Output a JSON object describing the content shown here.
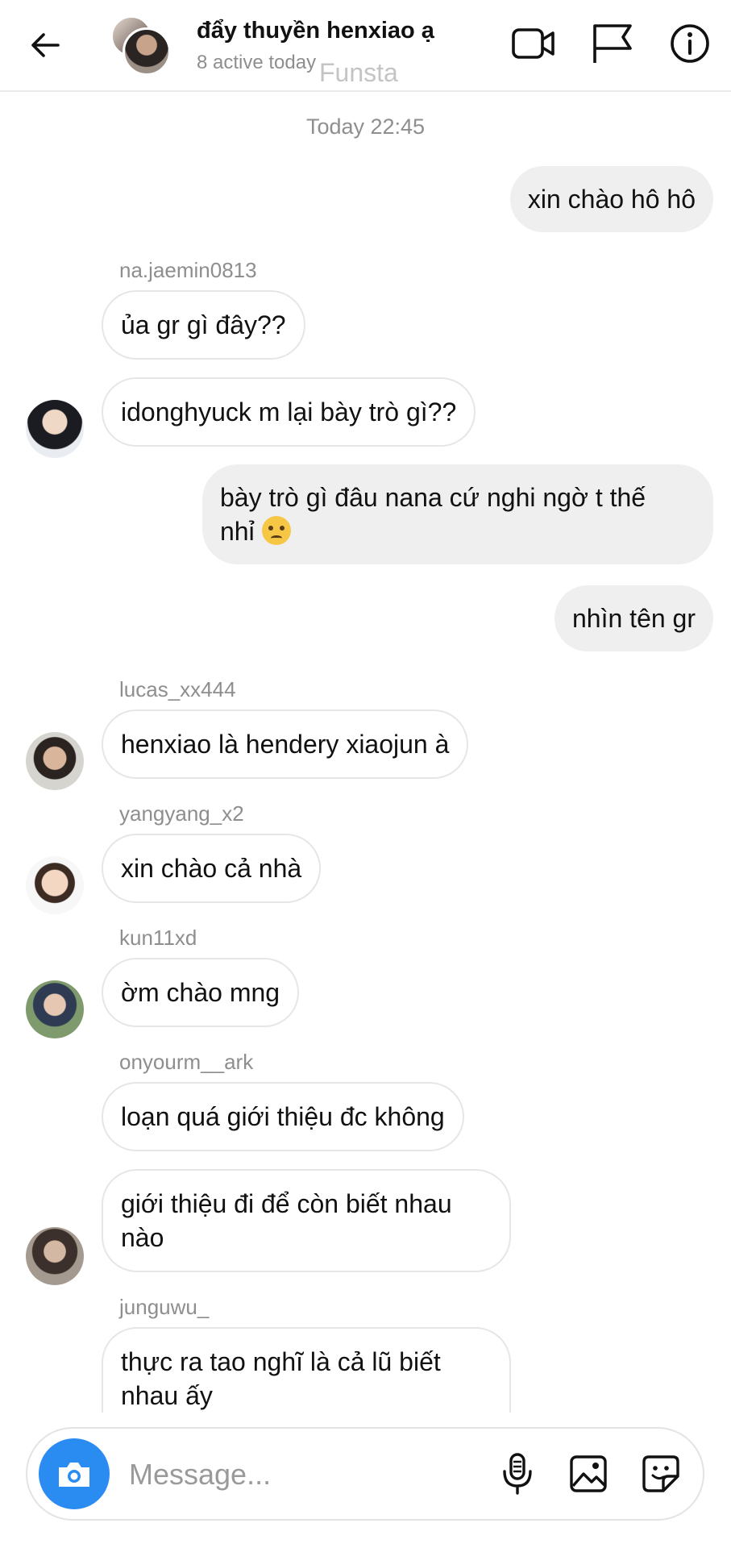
{
  "header": {
    "title": "đẩy thuyền henxiao ạ",
    "subtitle": "8 active today",
    "watermark": "Funsta",
    "icons": [
      "back-arrow-icon",
      "video-camera-icon",
      "flag-icon",
      "info-icon"
    ]
  },
  "timestamp": "Today 22:45",
  "messages": [
    {
      "direction": "out",
      "text": "xin chào hô hô"
    },
    {
      "direction": "in",
      "sender": "na.jaemin0813",
      "text": "ủa gr gì đây??"
    },
    {
      "direction": "in",
      "text": "idonghyuck m lại bày trò gì??"
    },
    {
      "direction": "out",
      "text_line1": "bày trò gì đâu nana cứ nghi ngờ t thế",
      "text_line2": "nhỉ",
      "emoji": "angry-face-emoji"
    },
    {
      "direction": "out",
      "text": "nhìn tên gr"
    },
    {
      "direction": "in",
      "sender": "lucas_xx444",
      "text": "henxiao là hendery xiaojun à"
    },
    {
      "direction": "in",
      "sender": "yangyang_x2",
      "text": "xin chào cả nhà"
    },
    {
      "direction": "in",
      "sender": "kun11xd",
      "text": "ờm chào mng"
    },
    {
      "direction": "in",
      "sender": "onyourm__ark",
      "text": "loạn quá giới thiệu đc không"
    },
    {
      "direction": "in",
      "text_line1": "giới thiệu đi để còn biết nhau",
      "text_line2": "nào"
    },
    {
      "direction": "in",
      "sender": "junguwu_",
      "text_line1": "thực ra tao nghĩ là cả lũ biết",
      "text_line2": "nhau ấy"
    }
  ],
  "composer": {
    "placeholder": "Message...",
    "value": "",
    "icons": [
      "camera-icon",
      "microphone-icon",
      "gallery-icon",
      "sticker-icon"
    ]
  },
  "colors": {
    "accent": "#2a8cf0",
    "outgoing_bubble": "#efefef",
    "incoming_border": "#e6e6e6",
    "muted_text": "#8e8e8e"
  }
}
